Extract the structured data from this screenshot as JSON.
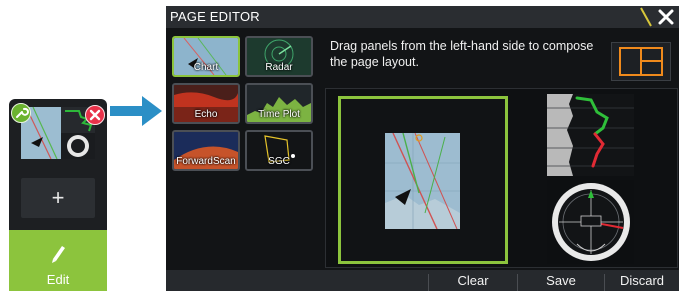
{
  "editor": {
    "title": "PAGE EDITOR",
    "instructions": "Drag panels from the left-hand side to compose the page layout."
  },
  "panels": [
    {
      "label": "Chart"
    },
    {
      "label": "Radar"
    },
    {
      "label": "Echo"
    },
    {
      "label": "Time Plot"
    },
    {
      "label": "ForwardScan"
    },
    {
      "label": "SGC"
    }
  ],
  "buttons": {
    "clear": "Clear",
    "save": "Save",
    "discard": "Discard"
  },
  "device": {
    "plus": "+",
    "edit": "Edit"
  },
  "colors": {
    "accent_green": "#8cc43d",
    "arrow_blue": "#2b8fc6",
    "close_red": "#e8324a",
    "layout_orange": "#f08a1c",
    "title_accent_yellow": "#d7c73a"
  }
}
